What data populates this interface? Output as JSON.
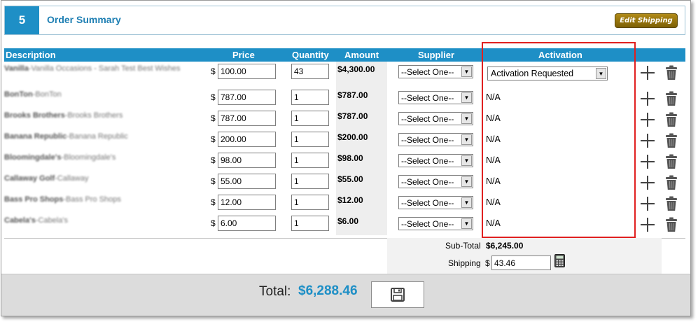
{
  "section": {
    "step": "5",
    "title": "Order Summary",
    "edit_shipping_label": "Edit Shipping"
  },
  "columns": {
    "description": "Description",
    "price": "Price",
    "quantity": "Quantity",
    "amount": "Amount",
    "supplier": "Supplier",
    "activation": "Activation"
  },
  "rows": [
    {
      "brand": "Vanilla",
      "item": "Vanilla Occasions - Sarah Test Best Wishes",
      "currency": "$",
      "price": "100.00",
      "qty": "43",
      "amount": "$4,300.00",
      "supplier": "--Select One--",
      "activation": "Activation Requested"
    },
    {
      "brand": "BonTon",
      "item": "BonTon",
      "currency": "$",
      "price": "787.00",
      "qty": "1",
      "amount": "$787.00",
      "supplier": "--Select One--",
      "activation": "N/A"
    },
    {
      "brand": "Brooks Brothers",
      "item": "Brooks Brothers",
      "currency": "$",
      "price": "787.00",
      "qty": "1",
      "amount": "$787.00",
      "supplier": "--Select One--",
      "activation": "N/A"
    },
    {
      "brand": "Banana Republic",
      "item": "Banana Republic",
      "currency": "$",
      "price": "200.00",
      "qty": "1",
      "amount": "$200.00",
      "supplier": "--Select One--",
      "activation": "N/A"
    },
    {
      "brand": "Bloomingdale's",
      "item": "Bloomingdale's",
      "currency": "$",
      "price": "98.00",
      "qty": "1",
      "amount": "$98.00",
      "supplier": "--Select One--",
      "activation": "N/A"
    },
    {
      "brand": "Callaway Golf",
      "item": "Callaway",
      "currency": "$",
      "price": "55.00",
      "qty": "1",
      "amount": "$55.00",
      "supplier": "--Select One--",
      "activation": "N/A"
    },
    {
      "brand": "Bass Pro Shops",
      "item": "Bass Pro Shops",
      "currency": "$",
      "price": "12.00",
      "qty": "1",
      "amount": "$12.00",
      "supplier": "--Select One--",
      "activation": "N/A"
    },
    {
      "brand": "Cabela's",
      "item": "Cabela's",
      "currency": "$",
      "price": "6.00",
      "qty": "1",
      "amount": "$6.00",
      "supplier": "--Select One--",
      "activation": "N/A"
    }
  ],
  "icons": {
    "add": "plus-icon",
    "delete": "trash-icon",
    "calculator": "calculator-icon",
    "save": "floppy-disk-icon"
  },
  "totals": {
    "subtotal_label": "Sub-Total",
    "subtotal_value": "$6,245.00",
    "shipping_label": "Shipping",
    "shipping_currency": "$",
    "shipping_value": "43.46",
    "total_label": "Total:",
    "total_value": "$6,288.46"
  },
  "colors": {
    "accent": "#1e8fc6",
    "highlight_border": "#e02020",
    "edit_button": "#8f700c"
  }
}
